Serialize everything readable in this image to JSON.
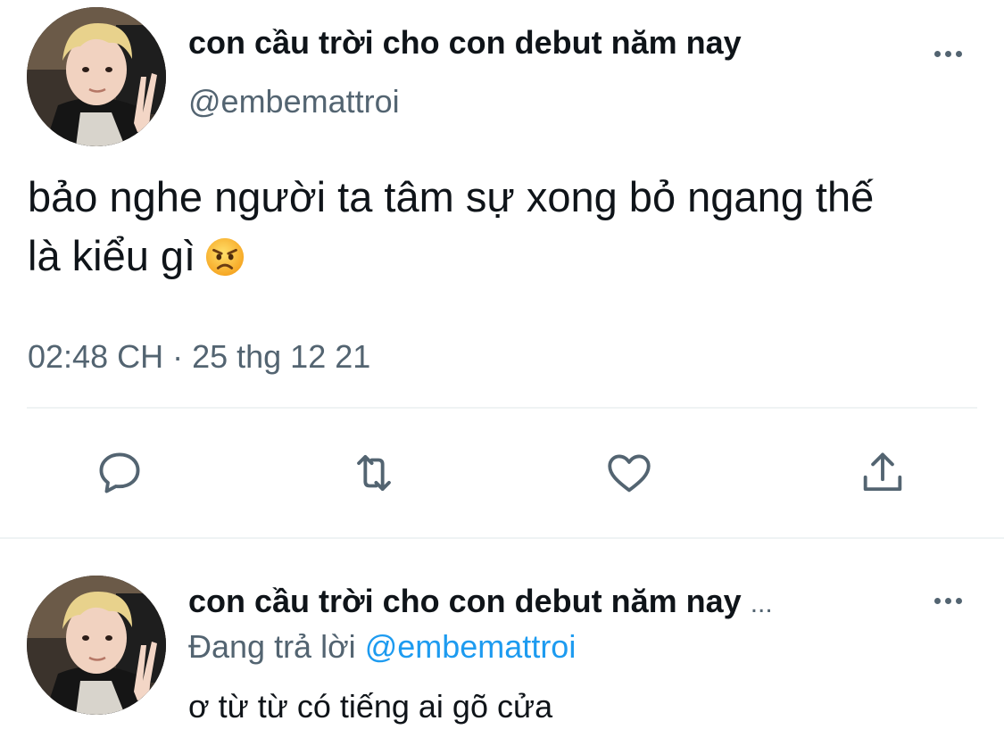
{
  "main_tweet": {
    "author_name": "con cầu trời cho con debut năm nay",
    "author_handle": "@embemattroi",
    "avatar_icon": "profile-photo",
    "text_line1": "bảo nghe người ta tâm sự xong bỏ ngang thế",
    "text_line2": "là kiểu gì",
    "emoji": "angry-face",
    "timestamp": "02:48 CH · 25 thg 12 21",
    "actions": {
      "reply_icon": "comment-icon",
      "retweet_icon": "retweet-icon",
      "like_icon": "heart-icon",
      "share_icon": "share-icon"
    }
  },
  "reply_tweet": {
    "author_name": "con cầu trời cho con debut năm nay",
    "name_ellipsis": "...",
    "replying_prefix": "Đang trả lời",
    "replying_to": "@embemattroi",
    "text": "ơ từ từ có tiếng ai gõ cửa"
  },
  "colors": {
    "primary_text": "#0f1419",
    "secondary_text": "#536471",
    "accent": "#1d9bf0",
    "divider": "#eff3f4"
  }
}
